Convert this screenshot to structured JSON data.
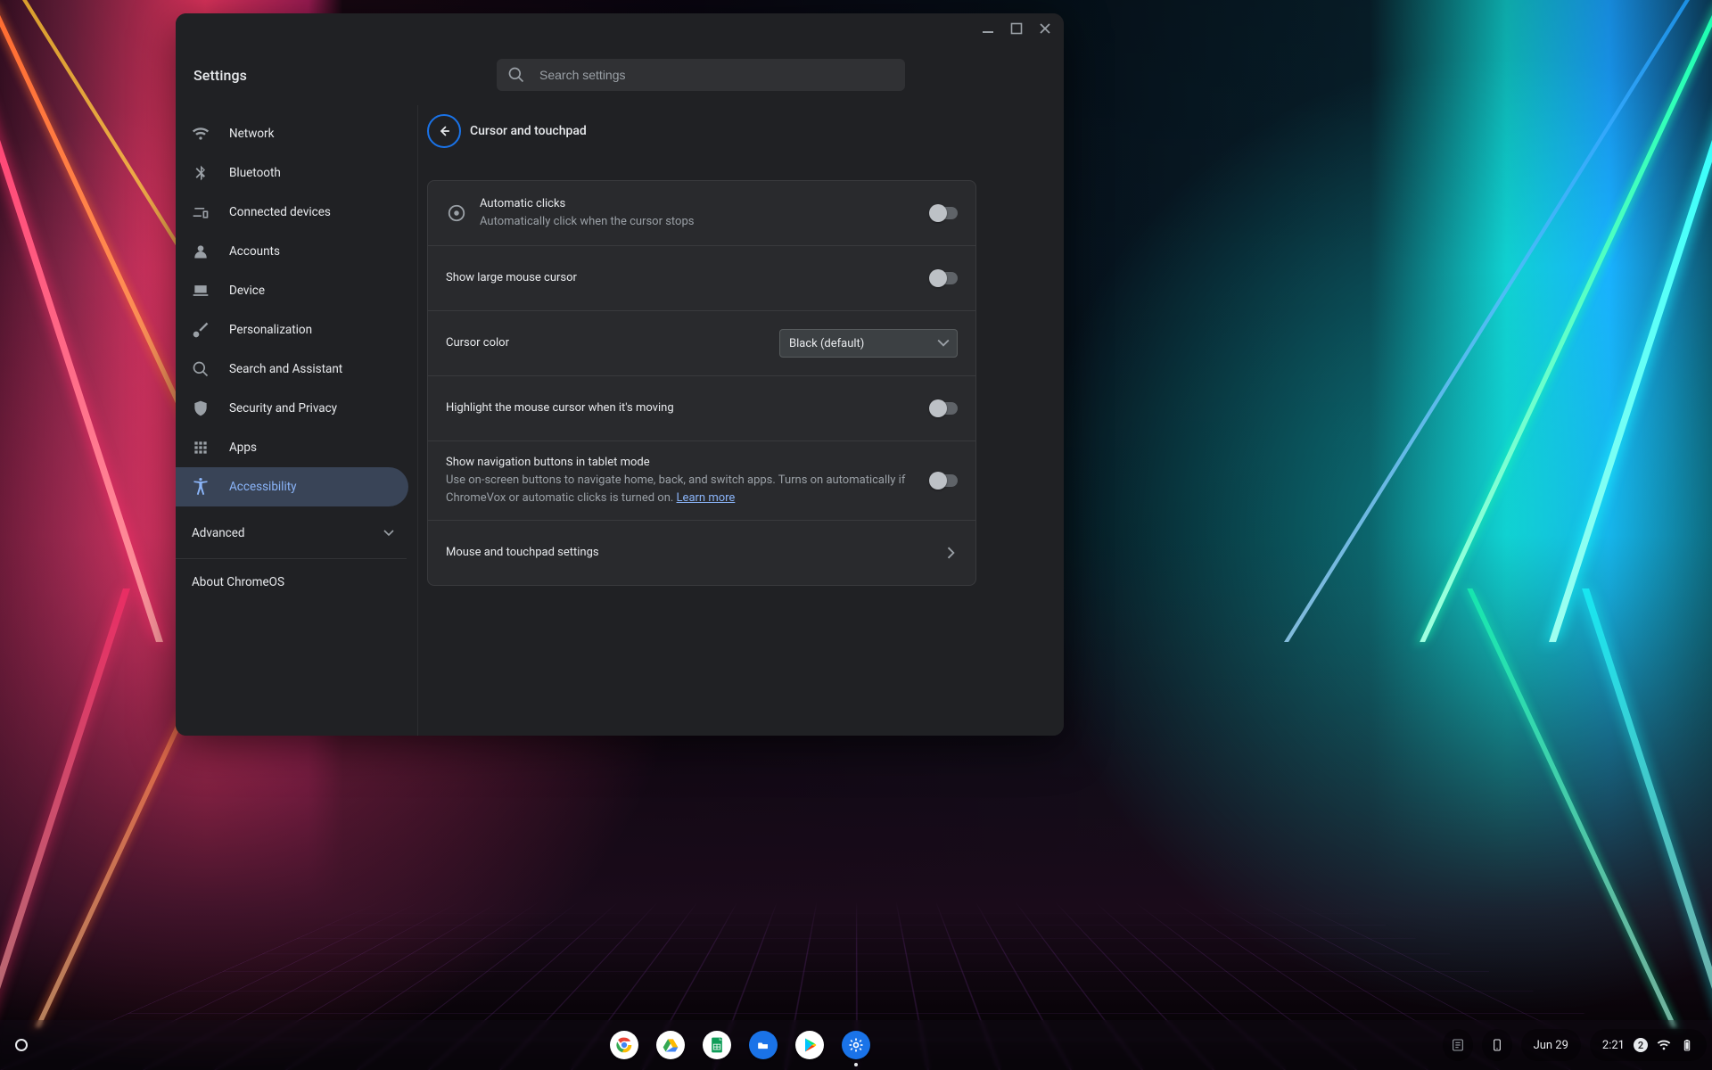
{
  "colors": {
    "accent": "#8ab4f8",
    "accent_strong": "#1a73e8",
    "surface": "#292a2d",
    "background": "#202124",
    "text": "#e8eaed",
    "text_secondary": "#9aa0a6"
  },
  "window": {
    "app_title": "Settings",
    "controls": {
      "minimize_icon": "minimize-icon",
      "maximize_icon": "maximize-icon",
      "close_icon": "close-icon"
    },
    "search": {
      "placeholder": "Search settings",
      "icon": "search-icon"
    }
  },
  "sidebar": {
    "items": [
      {
        "id": "network",
        "icon": "wifi-icon",
        "label": "Network"
      },
      {
        "id": "bluetooth",
        "icon": "bluetooth-icon",
        "label": "Bluetooth"
      },
      {
        "id": "connected-devices",
        "icon": "devices-icon",
        "label": "Connected devices"
      },
      {
        "id": "accounts",
        "icon": "person-icon",
        "label": "Accounts"
      },
      {
        "id": "device",
        "icon": "laptop-icon",
        "label": "Device"
      },
      {
        "id": "personalization",
        "icon": "brush-icon",
        "label": "Personalization"
      },
      {
        "id": "search-assistant",
        "icon": "search-icon",
        "label": "Search and Assistant"
      },
      {
        "id": "security-privacy",
        "icon": "shield-icon",
        "label": "Security and Privacy"
      },
      {
        "id": "apps",
        "icon": "apps-icon",
        "label": "Apps"
      },
      {
        "id": "accessibility",
        "icon": "accessibility-icon",
        "label": "Accessibility",
        "active": true
      }
    ],
    "advanced": {
      "label": "Advanced",
      "expanded": false,
      "icon": "chevron-down-icon"
    },
    "about": {
      "label": "About ChromeOS"
    }
  },
  "page": {
    "back_icon": "arrow-back-icon",
    "title": "Cursor and touchpad",
    "rows": [
      {
        "id": "automatic-clicks",
        "lead_icon": "target-icon",
        "title": "Automatic clicks",
        "sub": "Automatically click when the cursor stops",
        "control": {
          "type": "toggle",
          "value": false
        }
      },
      {
        "id": "large-cursor",
        "title": "Show large mouse cursor",
        "control": {
          "type": "toggle",
          "value": false
        }
      },
      {
        "id": "cursor-color",
        "title": "Cursor color",
        "control": {
          "type": "dropdown",
          "value": "Black (default)",
          "icon": "chevron-down-icon"
        }
      },
      {
        "id": "highlight-cursor",
        "title": "Highlight the mouse cursor when it's moving",
        "control": {
          "type": "toggle",
          "value": false
        }
      },
      {
        "id": "nav-buttons-tablet",
        "title": "Show navigation buttons in tablet mode",
        "sub": "Use on-screen buttons to navigate home, back, and switch apps. Turns on automatically if ChromeVox or automatic clicks is turned on.",
        "link": "Learn more",
        "control": {
          "type": "toggle",
          "value": false
        }
      },
      {
        "id": "mouse-touchpad-settings",
        "title": "Mouse and touchpad settings",
        "control": {
          "type": "subpage",
          "icon": "chevron-right-icon"
        }
      }
    ]
  },
  "shelf": {
    "launcher_icon": "launcher-icon",
    "apps": [
      {
        "id": "chrome",
        "name": "Google Chrome",
        "icon": "chrome-icon"
      },
      {
        "id": "drive",
        "name": "Google Drive",
        "icon": "drive-icon"
      },
      {
        "id": "sheets",
        "name": "Google Sheets",
        "icon": "sheets-icon"
      },
      {
        "id": "files",
        "name": "Files",
        "icon": "files-icon"
      },
      {
        "id": "play",
        "name": "Play Store",
        "icon": "play-icon"
      },
      {
        "id": "settings",
        "name": "Settings",
        "icon": "gear-icon",
        "active": true
      }
    ],
    "tote_icon": "tote-icon",
    "phone_hub_icon": "phone-icon",
    "status": {
      "date": "Jun 29",
      "time": "2:21",
      "notification_count": "2",
      "wifi_icon": "wifi-icon",
      "battery_icon": "battery-icon"
    }
  }
}
